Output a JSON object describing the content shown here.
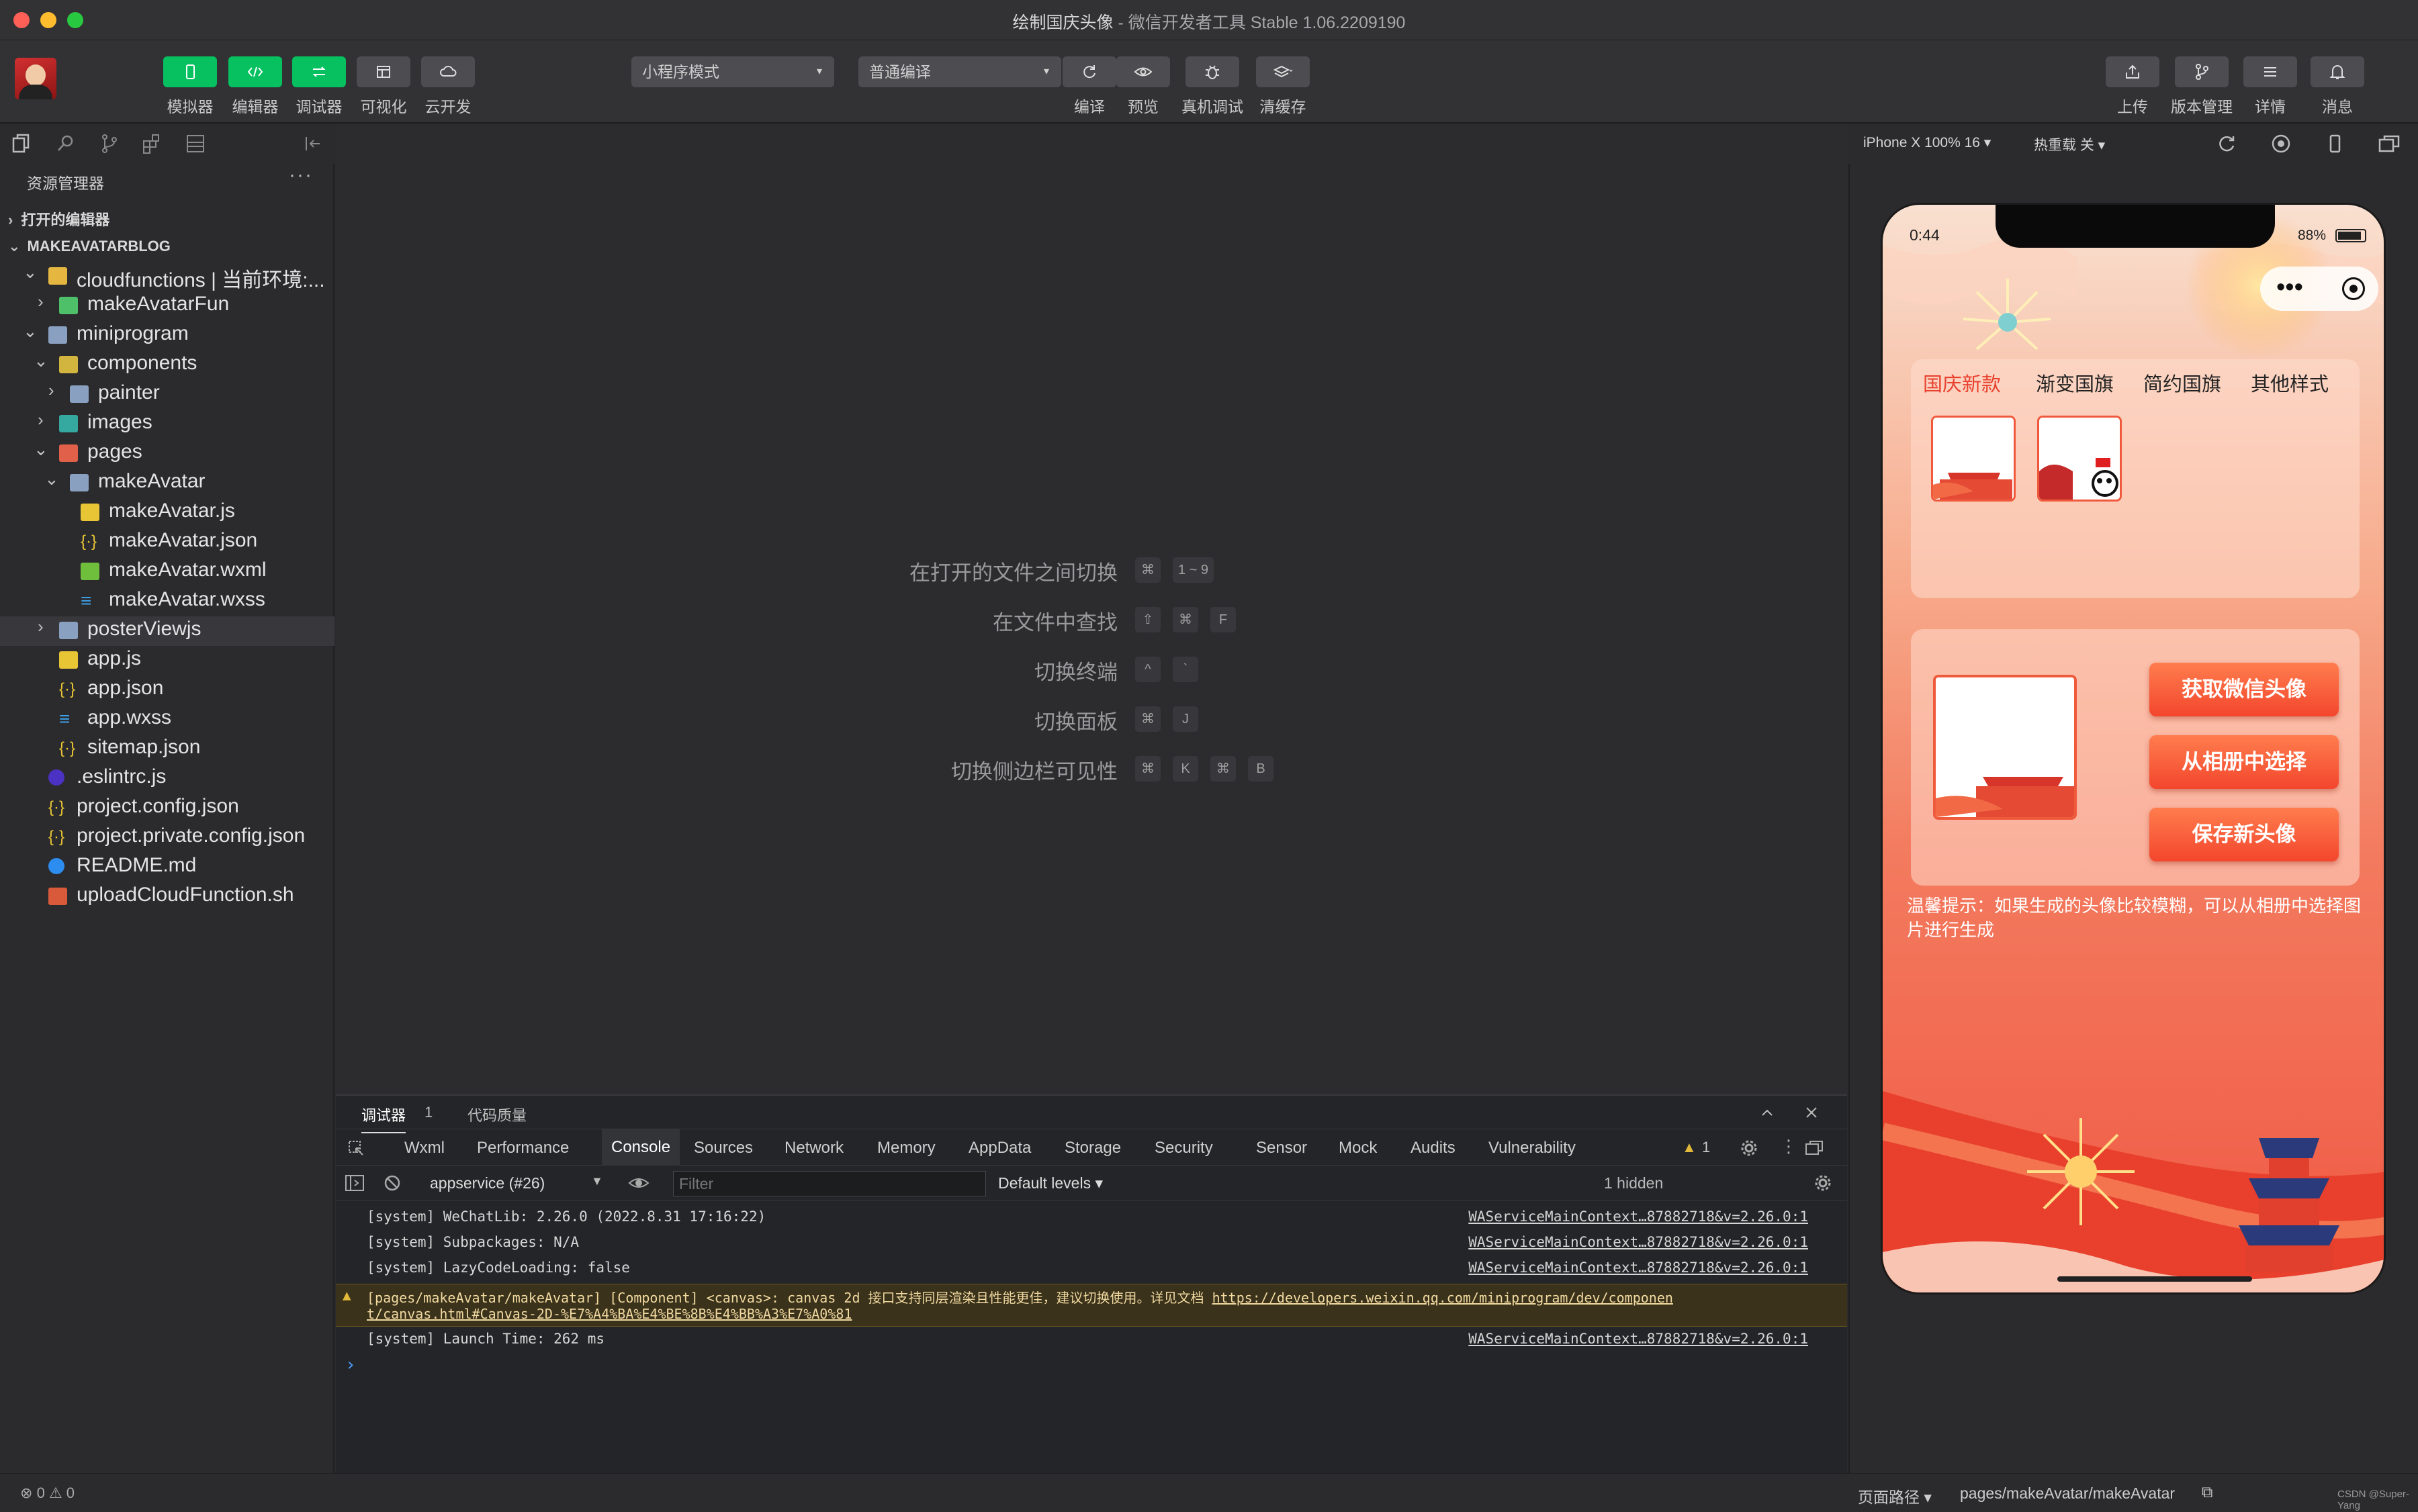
{
  "window": {
    "title_main": "绘制国庆头像",
    "title_sep": " - ",
    "title_app": "微信开发者工具 Stable 1.06.2209190"
  },
  "toolbar": {
    "view_buttons": [
      {
        "label": "模拟器",
        "icon": "phone-icon"
      },
      {
        "label": "编辑器",
        "icon": "code-icon"
      },
      {
        "label": "调试器",
        "icon": "debug-icon"
      },
      {
        "label": "可视化",
        "icon": "layout-icon"
      },
      {
        "label": "云开发",
        "icon": "cloud-icon"
      }
    ],
    "mode_select": "小程序模式",
    "compile_select": "普通编译",
    "actions": [
      {
        "label": "编译",
        "icon": "refresh-icon"
      },
      {
        "label": "预览",
        "icon": "eye-icon"
      },
      {
        "label": "真机调试",
        "icon": "bug-icon"
      },
      {
        "label": "清缓存",
        "icon": "layers-icon"
      }
    ],
    "right_actions": [
      {
        "label": "上传",
        "icon": "upload-icon"
      },
      {
        "label": "版本管理",
        "icon": "branch-icon"
      },
      {
        "label": "详情",
        "icon": "menu-icon"
      },
      {
        "label": "消息",
        "icon": "bell-icon"
      }
    ]
  },
  "explorer": {
    "title": "资源管理器",
    "more": "···",
    "open_editors": "打开的编辑器",
    "project": "MAKEAVATARBLOG",
    "tree": [
      {
        "label": "cloudfunctions | 当前环境:..."
      },
      {
        "label": "makeAvatarFun"
      },
      {
        "label": "miniprogram"
      },
      {
        "label": "components"
      },
      {
        "label": "painter"
      },
      {
        "label": "images"
      },
      {
        "label": "pages"
      },
      {
        "label": "makeAvatar"
      },
      {
        "label": "makeAvatar.js"
      },
      {
        "label": "makeAvatar.json"
      },
      {
        "label": "makeAvatar.wxml"
      },
      {
        "label": "makeAvatar.wxss"
      },
      {
        "label": "posterViewjs"
      },
      {
        "label": "app.js"
      },
      {
        "label": "app.json"
      },
      {
        "label": "app.wxss"
      },
      {
        "label": "sitemap.json"
      },
      {
        "label": ".eslintrc.js"
      },
      {
        "label": "project.config.json"
      },
      {
        "label": "project.private.config.json"
      },
      {
        "label": "README.md"
      },
      {
        "label": "uploadCloudFunction.sh"
      }
    ]
  },
  "shortcuts": [
    {
      "label": "在打开的文件之间切换",
      "keys": [
        "⌘",
        "1 ~ 9"
      ]
    },
    {
      "label": "在文件中查找",
      "keys": [
        "⇧",
        "⌘",
        "F"
      ]
    },
    {
      "label": "切换终端",
      "keys": [
        "^",
        "`"
      ]
    },
    {
      "label": "切换面板",
      "keys": [
        "⌘",
        "J"
      ]
    },
    {
      "label": "切换侧边栏可见性",
      "keys": [
        "⌘",
        "K",
        "⌘",
        "B"
      ]
    }
  ],
  "devtools": {
    "top_tabs": [
      {
        "label": "调试器"
      },
      {
        "label": "1"
      },
      {
        "label": "代码质量"
      }
    ],
    "tabs": [
      "Wxml",
      "Performance",
      "Console",
      "Sources",
      "Network",
      "Memory",
      "AppData",
      "Storage",
      "Security",
      "Sensor",
      "Mock",
      "Audits",
      "Vulnerability"
    ],
    "warning_count": "1",
    "context": "appservice (#26)",
    "filter_placeholder": "Filter",
    "levels": "Default levels",
    "hidden": "1 hidden",
    "logs": [
      {
        "text": "[system] WeChatLib: 2.26.0 (2022.8.31 17:16:22)",
        "src": "WAServiceMainContext…87882718&v=2.26.0:1"
      },
      {
        "text": "[system] Subpackages: N/A",
        "src": "WAServiceMainContext…87882718&v=2.26.0:1"
      },
      {
        "text": "[system] LazyCodeLoading: false",
        "src": "WAServiceMainContext…87882718&v=2.26.0:1"
      }
    ],
    "warning": {
      "line1": "[pages/makeAvatar/makeAvatar] [Component] <canvas>: canvas 2d 接口支持同层渲染且性能更佳，建议切换使用。详见文档 ",
      "link1": "https://developers.weixin.qq.com/miniprogram/dev/componen",
      "link2": "t/canvas.html#Canvas-2D-%E7%A4%BA%E4%BE%8B%E4%BB%A3%E7%A0%81"
    },
    "launch": {
      "text": "[system] Launch Time: 262 ms",
      "src": "WAServiceMainContext…87882718&v=2.26.0:1"
    },
    "prompt": "›"
  },
  "simulator": {
    "device": "iPhone X 100% 16 ▾",
    "hot_reload": "热重载 关 ▾",
    "status_time": "0:44",
    "battery": "88%",
    "capsule_dots": "•••",
    "tabs": [
      "国庆新款",
      "渐变国旗",
      "简约国旗",
      "其他样式"
    ],
    "buttons": [
      "获取微信头像",
      "从相册中选择",
      "保存新头像"
    ],
    "tip": "温馨提示：如果生成的头像比较模糊，可以从相册中选择图片进行生成"
  },
  "status": {
    "errors": "0",
    "warnings": "0",
    "path_label": "页面路径 ▾",
    "path": "pages/makeAvatar/makeAvatar",
    "watermark": "CSDN @Super-Yang"
  },
  "colors": {
    "accent": "#07c160",
    "active_tab": "#e8402d"
  }
}
